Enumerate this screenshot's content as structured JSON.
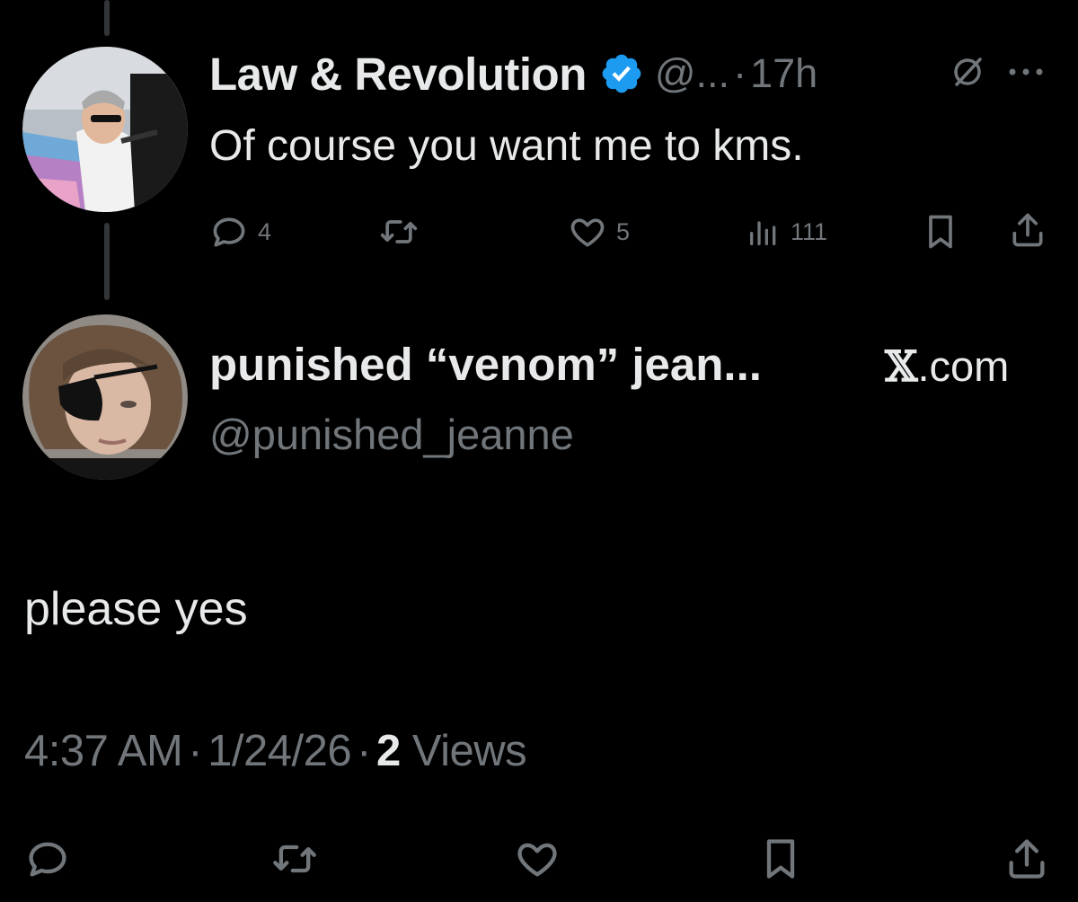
{
  "parent_tweet": {
    "author_name": "Law & Revolution",
    "handle": "@...",
    "separator": "·",
    "time": "17h",
    "text": "Of course you want me to kms.",
    "actions": {
      "replies": "4",
      "reposts": "",
      "likes": "5",
      "views": "111"
    }
  },
  "reply_tweet": {
    "author_name": "punished “venom” jean...",
    "handle": "@punished_jeanne",
    "source_mark": "𝕏",
    "source_domain": ".com",
    "text": "please yes",
    "timestamp_time": "4:37 AM",
    "timestamp_date": "1/24/26",
    "separator": "·",
    "views_count": "2",
    "views_label": "Views"
  },
  "icons": {
    "verified": "verified-badge-icon",
    "grok": "grok-icon",
    "more": "more-icon",
    "reply": "reply-icon",
    "repost": "repost-icon",
    "like": "like-icon",
    "views": "views-icon",
    "bookmark": "bookmark-icon",
    "share": "share-icon"
  },
  "colors": {
    "background": "#000000",
    "primary_text": "#e7e9ea",
    "secondary_text": "#71767b",
    "verified_blue": "#1d9bf0",
    "thread_line": "#333639"
  }
}
